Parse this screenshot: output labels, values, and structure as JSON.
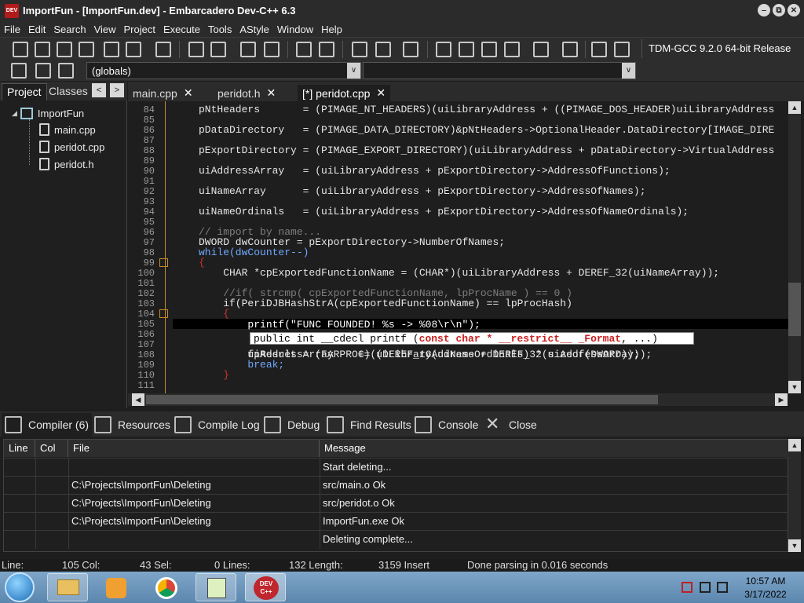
{
  "window": {
    "title": "ImportFun - [ImportFun.dev] - Embarcadero Dev-C++ 6.3",
    "app_icon_text": "DEV",
    "min": "‒",
    "max": "⧉",
    "close": "✕"
  },
  "menu": [
    "File",
    "Edit",
    "Search",
    "View",
    "Project",
    "Execute",
    "Tools",
    "AStyle",
    "Window",
    "Help"
  ],
  "toolbar": {
    "compiler": "TDM-GCC 9.2.0 64-bit Release",
    "scope": "(globals)",
    "dropdown_arrow": "∨"
  },
  "left_panel": {
    "tabs": [
      "Project",
      "Classes"
    ],
    "nav_prev": "<",
    "nav_next": ">",
    "tree_toggle": "◢",
    "project_name": "ImportFun",
    "files": [
      "main.cpp",
      "peridot.cpp",
      "peridot.h"
    ]
  },
  "editor_tabs": [
    {
      "label": "main.cpp",
      "close": "✕"
    },
    {
      "label": "peridot.h",
      "close": "✕"
    },
    {
      "label": "[*] peridot.cpp",
      "close": "✕"
    }
  ],
  "editor": {
    "lines": [
      {
        "n": "",
        "text": "pNtHeaders       = (PIMAGE_NT_HEADERS)(uiLibraryAddress + ((PIMAGE_DOS_HEADER)uiLibraryAddress"
      },
      {
        "n": "86",
        "text": "pDataDirectory   = (PIMAGE_DATA_DIRECTORY)&pNtHeaders->OptionalHeader.DataDirectory[IMAGE_DIRE"
      },
      {
        "n": "88",
        "text": "pExportDirectory = (PIMAGE_EXPORT_DIRECTORY)(uiLibraryAddress + pDataDirectory->VirtualAddress"
      },
      {
        "n": "90",
        "text": "uiAddressArray   = (uiLibraryAddress + pExportDirectory->AddressOfFunctions);"
      },
      {
        "n": "92",
        "text": "uiNameArray      = (uiLibraryAddress + pExportDirectory->AddressOfNames);"
      },
      {
        "n": "94",
        "text": "uiNameOrdinals   = (uiLibraryAddress + pExportDirectory->AddressOfNameOrdinals);"
      },
      {
        "n": "96",
        "text": "// import by name..."
      },
      {
        "n": "97",
        "text": "DWORD dwCounter = pExportDirectory->NumberOfNames;"
      },
      {
        "n": "98",
        "text": "while(dwCounter--)"
      },
      {
        "n": "99",
        "text": "{"
      },
      {
        "n": "100",
        "text": "    CHAR *cpExportedFunctionName = (CHAR*)(uiLibraryAddress + DEREF_32(uiNameArray));"
      },
      {
        "n": "102",
        "text": "    //if( strcmp( cpExportedFunctionName, lpProcName ) == 0 )"
      },
      {
        "n": "103",
        "text": "    if(PeriDJBHashStrA(cpExportedFunctionName) == lpProcHash)"
      },
      {
        "n": "104",
        "text": "    {"
      },
      {
        "n": "105",
        "text": "        printf(\"FUNC FOUNDED! %s -> %08\\r\\n\");"
      },
      {
        "n": "107",
        "text": "        uiAddressArray    += (DEREF_16(uiNameOrdinals) * sizeof(DWORD));"
      },
      {
        "n": "108",
        "text": "        fpResult = (FARPROC)(uiLibraryAddress + DEREF_32(uiAddressArray));"
      },
      {
        "n": "109",
        "text": "        break;"
      },
      {
        "n": "110",
        "text": "    }"
      },
      {
        "n": "111",
        "text": ""
      }
    ],
    "line_numbers": [
      "84",
      "85",
      "86",
      "87",
      "88",
      "89",
      "90",
      "91",
      "92",
      "93",
      "94",
      "95",
      "96",
      "97",
      "98",
      "99",
      "100",
      "101",
      "102",
      "103",
      "104",
      "105",
      "106",
      "107",
      "108",
      "109",
      "110",
      "111"
    ],
    "tooltip_prefix": "public int __cdecl printf (",
    "tooltip_highlight": "const char * __restrict__ _Format",
    "tooltip_suffix": ", ...)"
  },
  "bottom_tabs": [
    "Compiler (6)",
    "Resources",
    "Compile Log",
    "Debug",
    "Find Results",
    "Console",
    "Close"
  ],
  "messages": {
    "columns": [
      "Line",
      "Col",
      "File",
      "Message"
    ],
    "rows": [
      {
        "line": "",
        "col": "",
        "file": "",
        "message": "Start deleting..."
      },
      {
        "line": "",
        "col": "",
        "file": "C:\\Projects\\ImportFun\\Deleting",
        "message": "src/main.o Ok"
      },
      {
        "line": "",
        "col": "",
        "file": "C:\\Projects\\ImportFun\\Deleting",
        "message": "src/peridot.o Ok"
      },
      {
        "line": "",
        "col": "",
        "file": "C:\\Projects\\ImportFun\\Deleting",
        "message": "ImportFun.exe Ok"
      },
      {
        "line": "",
        "col": "",
        "file": "",
        "message": "Deleting complete..."
      }
    ]
  },
  "status": {
    "line_label": "Line:",
    "line_val": "105 Col:",
    "col_val": "43 Sel:",
    "sel_val": "0 Lines:",
    "lines_val": "132 Length:",
    "length_val": "3159 Insert",
    "parse_msg": "Done parsing in 0.016 seconds"
  },
  "taskbar": {
    "time": "10:57 AM",
    "date": "3/17/2022",
    "devcpp_label": "DEV C++"
  }
}
